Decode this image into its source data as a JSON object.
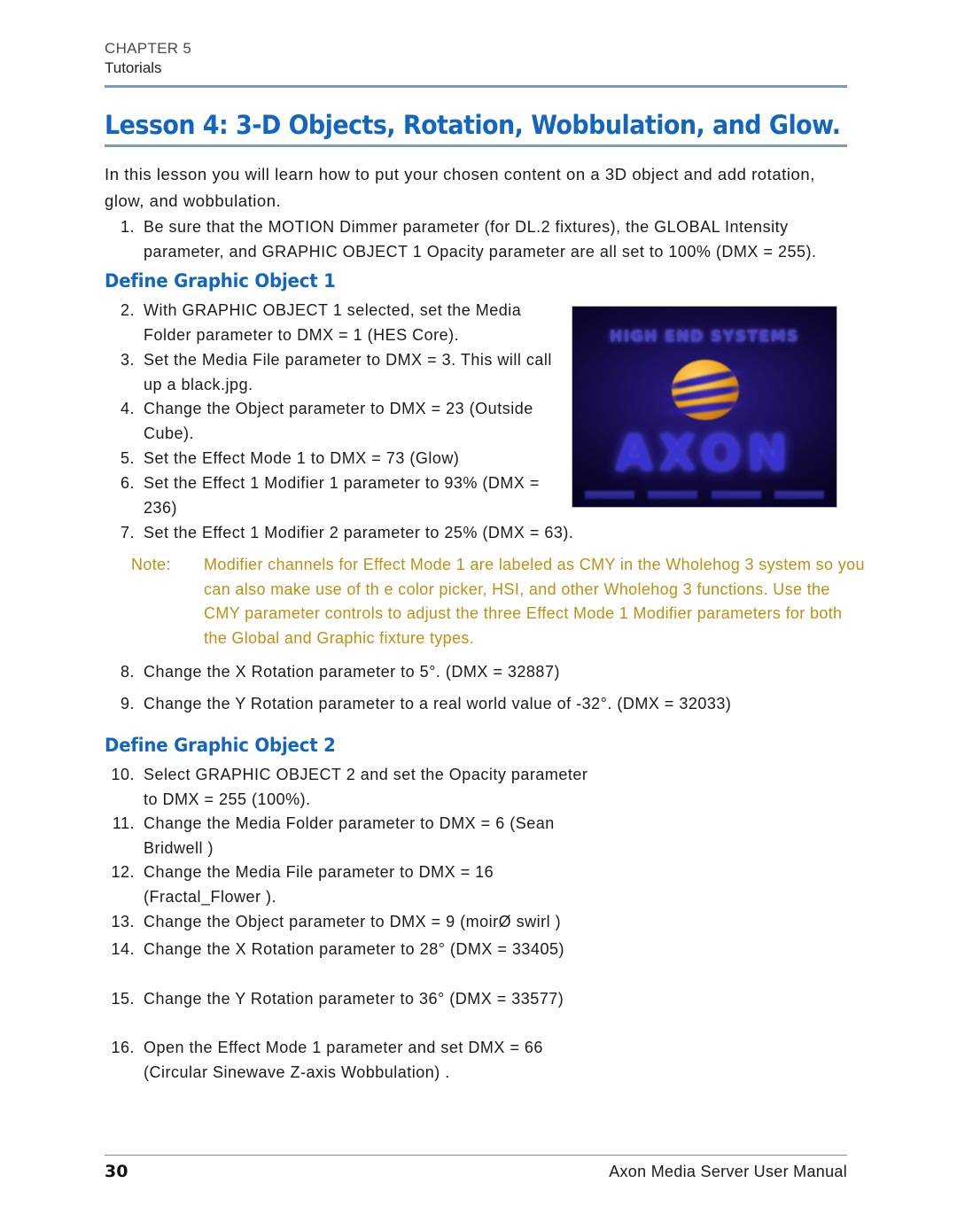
{
  "header": {
    "chapter": "CHAPTER 5",
    "section": "Tutorials"
  },
  "title": "Lesson 4: 3-D Objects, Rotation, Wobbulation, and Glow.",
  "intro": "In this lesson you will learn how to put your chosen content on a 3D object and add rotation, glow, and wobbulation.",
  "steps": [
    {
      "num": "1.",
      "text": "Be sure that the MOTION Dimmer   parameter (for DL.2 fixtures), the GLOBAL Intensity parameter, and GRAPHIC OBJECT 1 Opacity   parameter are all set to 100% (DMX = 255)."
    },
    {
      "num": "2.",
      "text": "With GRAPHIC OBJECT 1 selected, set the Media Folder   parameter to DMX = 1 (HES Core)."
    },
    {
      "num": "3.",
      "text": "Set the Media  File  parameter to DMX = 3. This will call up a black.jpg."
    },
    {
      "num": "4.",
      "text": "Change the Object   parameter to DMX = 23 (Outside Cube)."
    },
    {
      "num": "5.",
      "text": "Set the Effect Mode 1     to DMX = 73 (Glow)"
    },
    {
      "num": "6.",
      "text": "Set the Effect 1 Modifier 1      parameter to 93% (DMX = 236)"
    },
    {
      "num": "7.",
      "text": "Set the Effect 1 Modifier 2       parameter to 25% (DMX = 63)."
    },
    {
      "num": "8.",
      "text": "Change the X Rotation    parameter to 5°. (DMX = 32887)"
    },
    {
      "num": "9.",
      "text": "Change the Y Rotation    parameter to a real world value of -32°. (DMX = 32033)"
    },
    {
      "num": "10.",
      "text": "Select GRAPHIC OBJECT 2 and set the Opacity parameter to DMX = 255 (100%)."
    },
    {
      "num": "11.",
      "text": "Change the Media Folder    parameter to DMX = 6 (Sean Bridwell )"
    },
    {
      "num": "12.",
      "text": "Change the Media File   parameter to DMX = 16 (Fractal_Flower )."
    },
    {
      "num": "13.",
      "text": "Change the Object   parameter to DMX = 9 (moirØ swirl )"
    },
    {
      "num": "14.",
      "text": "Change the X Rotation    parameter to 28° (DMX = 33405)"
    },
    {
      "num": "15.",
      "text": "Change the Y Rotation    parameter to 36° (DMX = 33577)"
    },
    {
      "num": "16.",
      "text": "Open the Effect Mode 1    parameter and set DMX = 66 (Circular Sinewave   Z-axis Wobbulation)   ."
    }
  ],
  "section_headings": {
    "define_object_1": "Define Graphic Object 1",
    "define_object_2": "Define Graphic Object 2"
  },
  "note": {
    "label": "Note:",
    "text": "Modifier channels for Effect Mode     1 are labeled as CMY in the Wholehog 3 system so you can also make use of th    e color picker, HSI,   and other Wholehog 3 functions. Use the CMY parameter controls      to adjust the three Effect Mode 1 Modifier parameters for both the     Global and Graphic fixture types."
  },
  "figure": {
    "brand_top": "HIGH END SYSTEMS",
    "brand_main": "AXON"
  },
  "footer": {
    "page_number": "30",
    "manual": "Axon Media Server User Manual"
  },
  "colors": {
    "heading_blue": "#1266c0",
    "rule_blue": "#7c9cb6",
    "note_gold": "#bd8f14",
    "body_text": "#1a1a1a"
  }
}
